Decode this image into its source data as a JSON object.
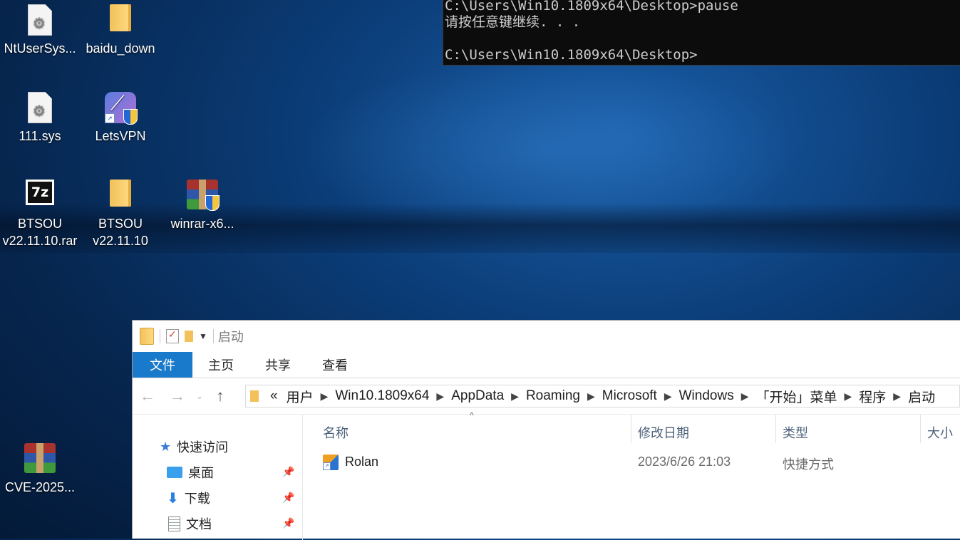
{
  "desktop": {
    "icons": [
      {
        "label": "NtUserSys...",
        "icon": "sys-file-icon"
      },
      {
        "label": "baidu_down",
        "icon": "folder-icon"
      },
      {
        "label": "111.sys",
        "icon": "sys-file-icon"
      },
      {
        "label": "LetsVPN",
        "icon": "letsvpn-icon"
      },
      {
        "label_line1": "BTSOU",
        "label_line2": "v22.11.10.rar",
        "icon": "7zip-archive-icon"
      },
      {
        "label_line1": "BTSOU",
        "label_line2": "v22.11.10",
        "icon": "folder-icon"
      },
      {
        "label": "winrar-x6...",
        "icon": "winrar-installer-icon"
      },
      {
        "label": "CVE-2025...",
        "icon": "winrar-archive-icon"
      }
    ]
  },
  "console": {
    "lines": [
      "C:\\Users\\Win10.1809x64\\Desktop>pause",
      "请按任意键继续. . .",
      "",
      "C:\\Users\\Win10.1809x64\\Desktop>"
    ]
  },
  "explorer": {
    "title": "启动",
    "ribbon": {
      "tabs": [
        "文件",
        "主页",
        "共享",
        "查看"
      ]
    },
    "nav_buttons": {
      "back": "←",
      "forward": "→",
      "recent": "⌄",
      "up": "↑"
    },
    "breadcrumb_prefix": "«",
    "breadcrumb": [
      "用户",
      "Win10.1809x64",
      "AppData",
      "Roaming",
      "Microsoft",
      "Windows",
      "「开始」菜单",
      "程序",
      "启动"
    ],
    "nav_pane": {
      "quick_access": "快速访问",
      "items": [
        "桌面",
        "下载",
        "文档"
      ]
    },
    "columns": {
      "name": "名称",
      "modified": "修改日期",
      "type": "类型",
      "size": "大小"
    },
    "files": [
      {
        "name": "Rolan",
        "modified": "2023/6/26 21:03",
        "type": "快捷方式",
        "icon": "rolan-shortcut-icon"
      }
    ]
  }
}
